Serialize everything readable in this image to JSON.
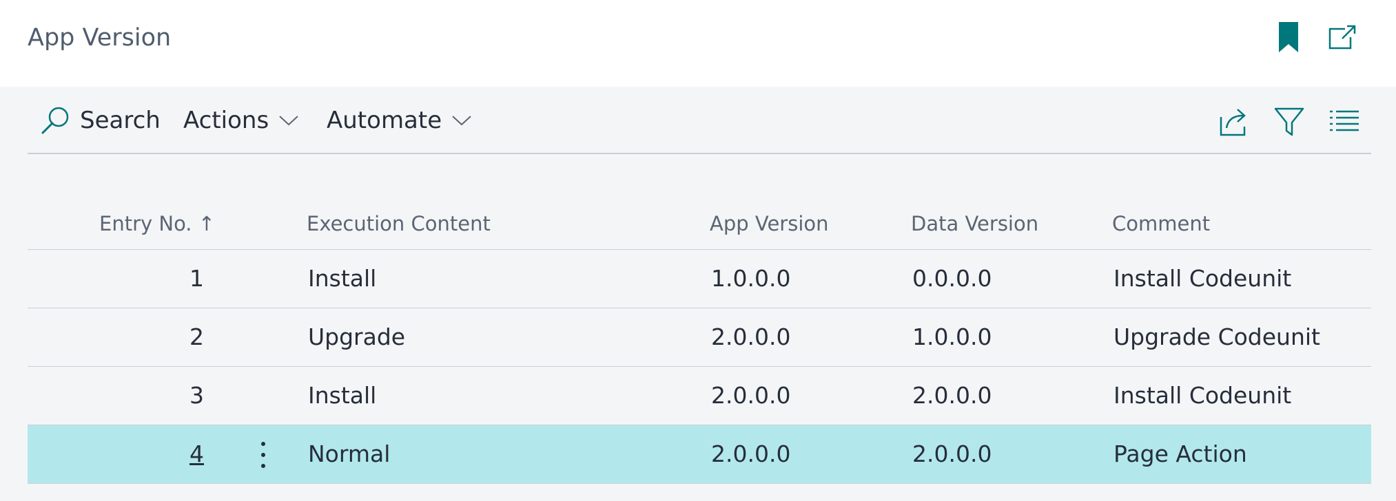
{
  "page": {
    "title": "App Version"
  },
  "toolbar": {
    "search_label": "Search",
    "actions_label": "Actions",
    "automate_label": "Automate"
  },
  "columns": {
    "entry_no": "Entry No.",
    "sort_indicator": "↑",
    "execution_content": "Execution Content",
    "app_version": "App Version",
    "data_version": "Data Version",
    "comment": "Comment"
  },
  "rows": [
    {
      "entry_no": "1",
      "execution_content": "Install",
      "app_version": "1.0.0.0",
      "data_version": "0.0.0.0",
      "comment": "Install Codeunit"
    },
    {
      "entry_no": "2",
      "execution_content": "Upgrade",
      "app_version": "2.0.0.0",
      "data_version": "1.0.0.0",
      "comment": "Upgrade Codeunit"
    },
    {
      "entry_no": "3",
      "execution_content": "Install",
      "app_version": "2.0.0.0",
      "data_version": "2.0.0.0",
      "comment": "Install Codeunit"
    },
    {
      "entry_no": "4",
      "execution_content": "Normal",
      "app_version": "2.0.0.0",
      "data_version": "2.0.0.0",
      "comment": "Page Action"
    }
  ],
  "selected_row": 3,
  "colors": {
    "accent": "#00777a",
    "selected_row_bg": "#b2e8ec",
    "background": "#f4f5f7",
    "text": "#262e3a"
  },
  "icons": {
    "bookmark": "bookmark-icon",
    "open_new_window": "open-in-new-window-icon",
    "search": "search-icon",
    "share": "share-icon",
    "filter": "filter-icon",
    "list": "list-view-icon"
  }
}
